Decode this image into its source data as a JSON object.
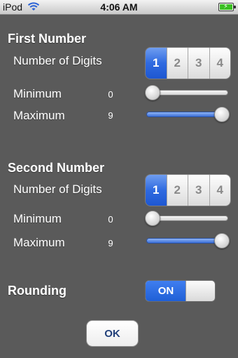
{
  "status": {
    "carrier": "iPod",
    "time": "4:06 AM"
  },
  "first": {
    "title": "First Number",
    "digits_label": "Number of Digits",
    "segments": [
      "1",
      "2",
      "3",
      "4"
    ],
    "selected_index": 0,
    "min_label": "Minimum",
    "min_value": "0",
    "min_slider_fraction": 0.0,
    "max_label": "Maximum",
    "max_value": "9",
    "max_slider_fraction": 1.0
  },
  "second": {
    "title": "Second Number",
    "digits_label": "Number of Digits",
    "segments": [
      "1",
      "2",
      "3",
      "4"
    ],
    "selected_index": 0,
    "min_label": "Minimum",
    "min_value": "0",
    "min_slider_fraction": 0.0,
    "max_label": "Maximum",
    "max_value": "9",
    "max_slider_fraction": 1.0
  },
  "rounding": {
    "label": "Rounding",
    "toggle_label": "ON",
    "on": true
  },
  "ok_label": "OK",
  "colors": {
    "background": "#5a5a5a",
    "accent_blue": "#2f6ae0",
    "ok_text": "#22407a"
  },
  "icons": {
    "wifi": "wifi-icon",
    "battery": "battery-charging-icon"
  }
}
